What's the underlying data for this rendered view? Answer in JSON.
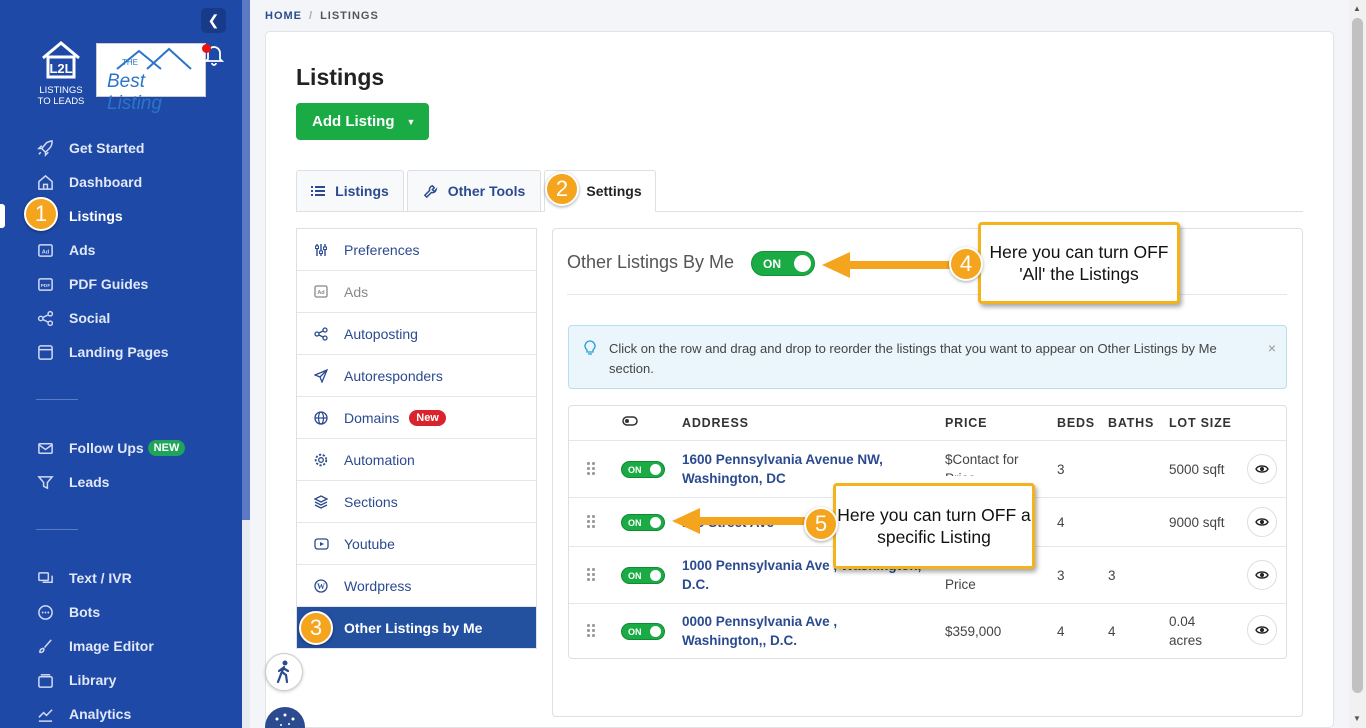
{
  "sidebar": {
    "logo_text_line1": "LISTINGS",
    "logo_text_line2": "TO LEADS",
    "brand_small": "THE",
    "brand_text": "Best Listing",
    "items": [
      {
        "label": "Get Started",
        "icon": "rocket-icon"
      },
      {
        "label": "Dashboard",
        "icon": "home-icon"
      },
      {
        "label": "Listings",
        "icon": "listings-icon"
      },
      {
        "label": "Ads",
        "icon": "ad-icon"
      },
      {
        "label": "PDF Guides",
        "icon": "pdf-icon"
      },
      {
        "label": "Social",
        "icon": "share-icon"
      },
      {
        "label": "Landing Pages",
        "icon": "page-icon"
      },
      {
        "label": "Follow Ups",
        "icon": "mail-icon",
        "badge": "NEW"
      },
      {
        "label": "Leads",
        "icon": "filter-icon"
      },
      {
        "label": "Text / IVR",
        "icon": "chat-icon"
      },
      {
        "label": "Bots",
        "icon": "bot-icon"
      },
      {
        "label": "Image Editor",
        "icon": "brush-icon"
      },
      {
        "label": "Library",
        "icon": "library-icon"
      },
      {
        "label": "Analytics",
        "icon": "analytics-icon"
      }
    ]
  },
  "breadcrumb": {
    "home": "HOME",
    "sep": "/",
    "current": "LISTINGS"
  },
  "page": {
    "title": "Listings",
    "add_button": "Add Listing"
  },
  "tabs": [
    {
      "label": "Listings"
    },
    {
      "label": "Other Tools"
    },
    {
      "label": "Settings"
    }
  ],
  "settings_menu": [
    {
      "label": "Preferences"
    },
    {
      "label": "Ads"
    },
    {
      "label": "Autoposting"
    },
    {
      "label": "Autoresponders"
    },
    {
      "label": "Domains",
      "badge": "New"
    },
    {
      "label": "Automation"
    },
    {
      "label": "Sections"
    },
    {
      "label": "Youtube"
    },
    {
      "label": "Wordpress"
    },
    {
      "label": "Other Listings by Me"
    }
  ],
  "panel": {
    "title": "Other Listings By Me",
    "toggle_label": "ON",
    "info_message": "Click on the row and drag and drop to reorder the listings that you want to appear on Other Listings by Me section.",
    "close_symbol": "×"
  },
  "table": {
    "headers": {
      "address": "ADDRESS",
      "price": "PRICE",
      "beds": "BEDS",
      "baths": "BATHS",
      "lot_size": "LOT SIZE"
    },
    "toggle_label": "ON",
    "rows": [
      {
        "address": "1600 Pennsylvania Avenue NW, Washington, DC",
        "price": "$Contact for Price",
        "beds": "3",
        "baths": "",
        "lot_size": "5000 sqft"
      },
      {
        "address": "100 Street Ave",
        "price": "",
        "beds": "4",
        "baths": "",
        "lot_size": "9000 sqft"
      },
      {
        "address": "1000 Pennsylvania Ave , Washington, D.C.",
        "price": "Price",
        "beds": "3",
        "baths": "3",
        "lot_size": ""
      },
      {
        "address": "0000 Pennsylvania Ave , Washington,, D.C.",
        "price": "$359,000",
        "beds": "4",
        "baths": "4",
        "lot_size": "0.04 acres"
      }
    ]
  },
  "annotations": {
    "step1": "1",
    "step2": "2",
    "step3": "3",
    "step4": "4",
    "step5": "5",
    "callout4": "Here you can turn OFF 'All' the Listings",
    "callout5": "Here you can turn OFF a specific Listing"
  },
  "colors": {
    "sidebar": "#1f49a6",
    "accent_green": "#1aab45",
    "annotation_orange": "#f4a41d",
    "active_menu": "#2450a0"
  }
}
